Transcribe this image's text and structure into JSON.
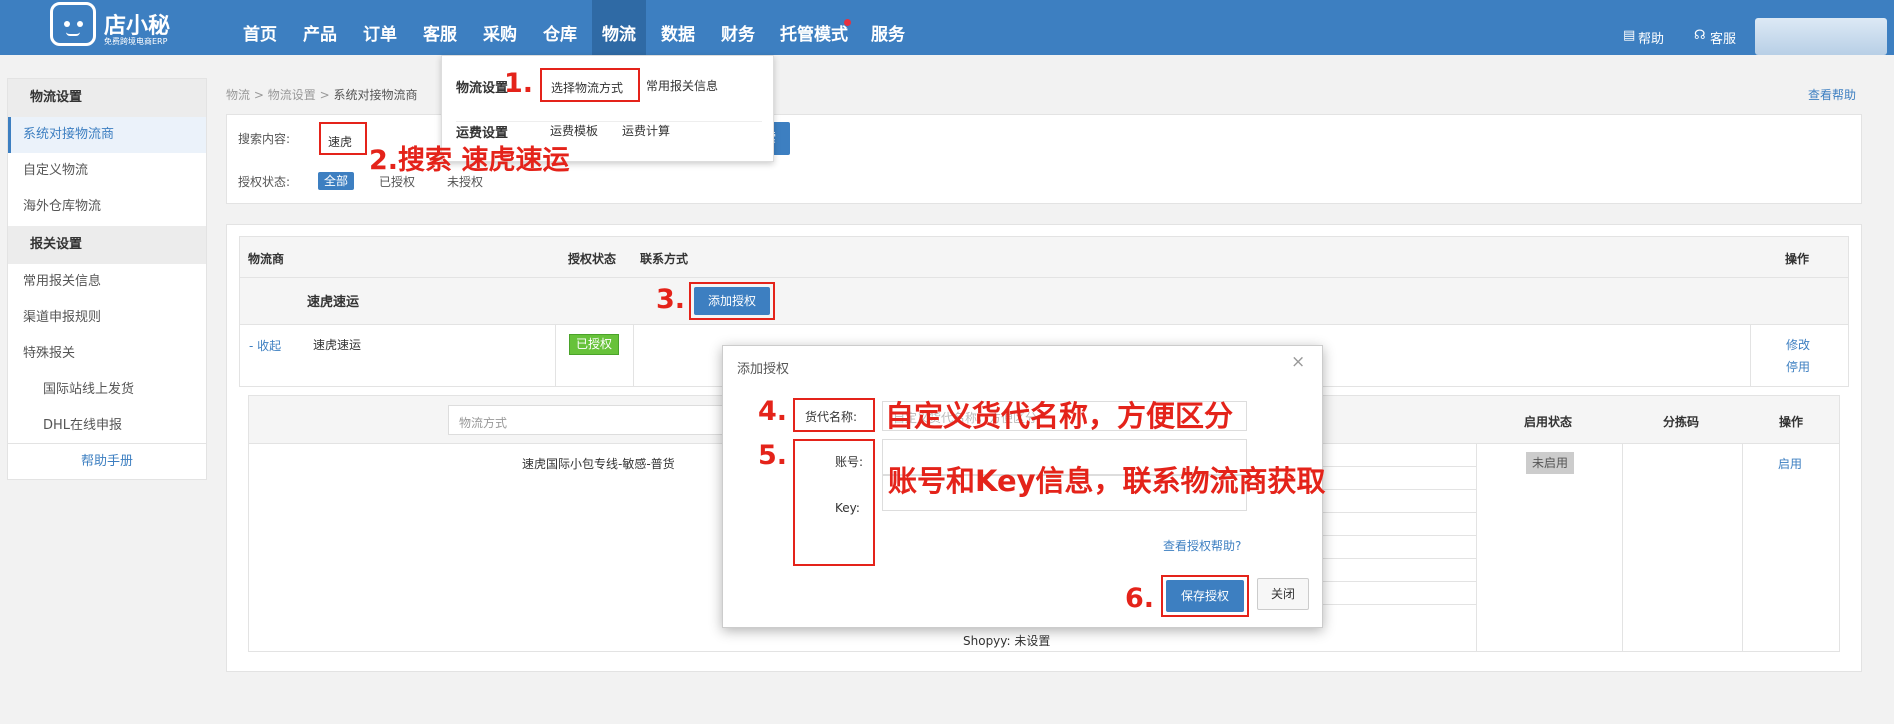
{
  "header": {
    "logo_text": "店小秘",
    "logo_sub": "免费跨境电商ERP",
    "nav": [
      "首页",
      "产品",
      "订单",
      "客服",
      "采购",
      "仓库",
      "物流",
      "数据",
      "财务",
      "托管模式",
      "服务"
    ],
    "help": "帮助",
    "service": "客服"
  },
  "dropdown": {
    "row1_title": "物流设置",
    "row1_items": [
      "选择物流方式",
      "常用报关信息"
    ],
    "row2_title": "运费设置",
    "row2_items": [
      "运费模板",
      "运费计算"
    ]
  },
  "sidebar": {
    "group1": "物流设置",
    "items1": [
      "系统对接物流商",
      "自定义物流",
      "海外仓库物流"
    ],
    "group2": "报关设置",
    "items2": [
      "常用报关信息",
      "渠道申报规则",
      "特殊报关"
    ],
    "subitems": [
      "国际站线上发货",
      "DHL在线申报"
    ],
    "manual": "帮助手册"
  },
  "breadcrumb": {
    "a": "物流",
    "b": "物流设置",
    "c": "系统对接物流商",
    "sep": ">"
  },
  "help_link": "查看帮助",
  "search": {
    "label": "搜索内容:",
    "value": "速虎",
    "btn_fragment": "索",
    "status_label": "授权状态:",
    "filters": [
      "全部",
      "已授权",
      "未授权"
    ]
  },
  "table": {
    "headers": [
      "物流商",
      "授权状态",
      "联系方式",
      "操作"
    ],
    "group_row": {
      "name": "速虎速运",
      "add_btn": "添加授权"
    },
    "row": {
      "toggle": "- 收起",
      "name": "速虎速运",
      "status": "已授权",
      "actions": [
        "修改",
        "停用"
      ]
    },
    "sub": {
      "input_placeholder": "物流方式",
      "headers": [
        "启用状态",
        "分拣码",
        "操作"
      ],
      "method": "速虎国际小包专线-敏感-普货",
      "enable_status": "未启用",
      "enable_action": "启用",
      "shopyy": "Shopyy:  未设置"
    }
  },
  "modal": {
    "title": "添加授权",
    "close": "×",
    "field1": "货代名称:",
    "field1_ph": "自定义货代名称，方便区分",
    "field2": "账号:",
    "field3": "Key:",
    "help": "查看授权帮助?",
    "save": "保存授权",
    "cancel": "关闭"
  },
  "annotations": {
    "a1": "1.",
    "a2": "2.",
    "a2_text": "搜索 速虎速运",
    "a3": "3.",
    "a4": "4.",
    "a4_text": "自定义货代名称，方便区分",
    "a5": "5.",
    "a5_text": "账号和Key信息，联系物流商获取",
    "a6": "6."
  },
  "colors": {
    "brand": "#3d7fc1",
    "annotation": "#e4231a",
    "authorized": "#67c23a"
  }
}
